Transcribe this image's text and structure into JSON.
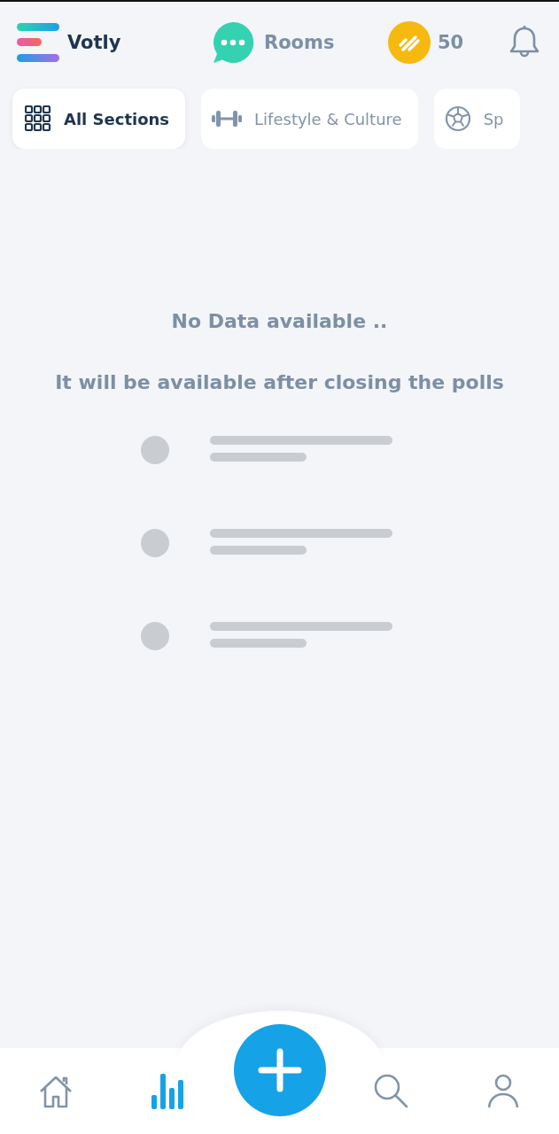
{
  "header": {
    "brand": "Votly",
    "rooms": "Rooms",
    "coins": "50"
  },
  "sections": [
    {
      "label": "All Sections",
      "kind": "grid",
      "selected": true
    },
    {
      "label": "Lifestyle & Culture",
      "kind": "dumbbell",
      "selected": false
    },
    {
      "label": "Sp",
      "kind": "ball",
      "selected": false
    }
  ],
  "empty_state": {
    "title": "No Data available ..",
    "message": "It will be available after closing the polls"
  },
  "placeholder_rows": [
    {
      "kind": "skeleton"
    },
    {
      "kind": "skeleton"
    },
    {
      "kind": "skeleton"
    }
  ],
  "nav": [
    {
      "kind": "home",
      "selected": false
    },
    {
      "kind": "stats",
      "selected": true
    },
    {
      "kind": "add",
      "selected": false
    },
    {
      "kind": "search",
      "selected": false
    },
    {
      "kind": "profile",
      "selected": false
    }
  ]
}
